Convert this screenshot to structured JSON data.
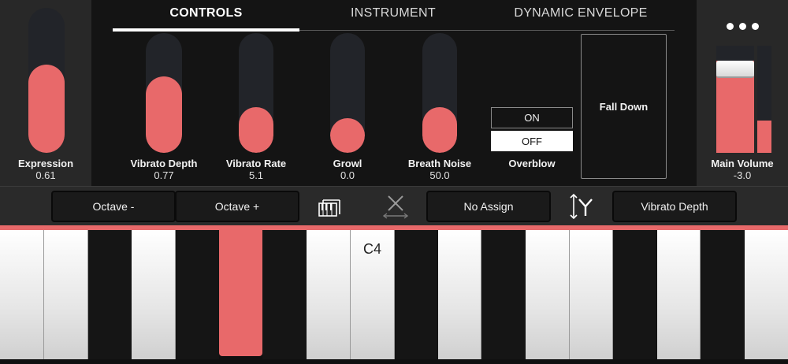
{
  "tabs": [
    {
      "label": "CONTROLS",
      "active": true
    },
    {
      "label": "INSTRUMENT",
      "active": false
    },
    {
      "label": "DYNAMIC ENVELOPE",
      "active": false
    }
  ],
  "expression": {
    "label": "Expression",
    "value": "0.61",
    "level": 0.61
  },
  "sliders": [
    {
      "label": "Vibrato Depth",
      "value": "0.77",
      "level": 0.64
    },
    {
      "label": "Vibrato Rate",
      "value": "5.1",
      "level": 0.38
    },
    {
      "label": "Growl",
      "value": "0.0",
      "level": 0.0
    },
    {
      "label": "Breath Noise",
      "value": "50.0",
      "level": 0.38
    }
  ],
  "overblow": {
    "label": "Overblow",
    "on_label": "ON",
    "off_label": "OFF",
    "selected": "OFF"
  },
  "fall": {
    "label": "Fall Down"
  },
  "menu": {
    "icon": "more-icon"
  },
  "main_volume": {
    "label": "Main Volume",
    "value": "-3.0",
    "level": 0.86,
    "meter_level": 0.3
  },
  "toolbar": {
    "octave_down": "Octave -",
    "octave_up": "Octave +",
    "x_assign": "No Assign",
    "y_assign": "Vibrato Depth"
  },
  "keyboard": {
    "note_label": "C4",
    "highlight_color": "#e8696a",
    "accent_color": "#e8696a"
  }
}
